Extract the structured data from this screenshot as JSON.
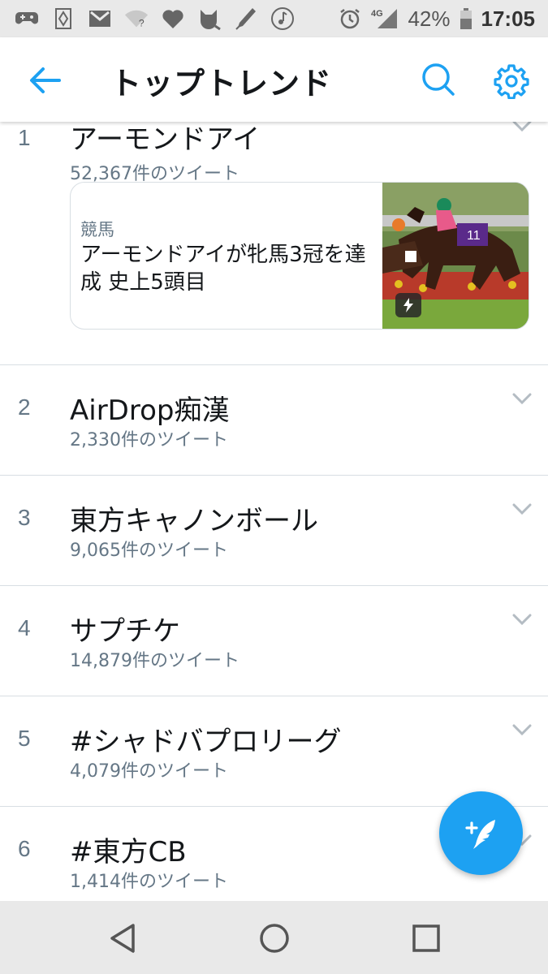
{
  "status_bar": {
    "left_icons": [
      "game-controller-icon",
      "sync-diamond-icon",
      "gmail-icon",
      "wifi-unknown-icon",
      "heart-icon",
      "cat-icon",
      "pen-icon",
      "music-note-icon"
    ],
    "network": "4G",
    "battery": "42%",
    "time": "17:05"
  },
  "app_bar": {
    "title": "トップトレンド",
    "accent_color": "#1da1f2"
  },
  "trends": [
    {
      "rank": "1",
      "name": "アーモンドアイ",
      "count": "52,367件のツイート",
      "news": {
        "category": "競馬",
        "headline": "アーモンドアイが牝馬3冠を達成 史上5頭目",
        "thumbnail": "horse-race-photo",
        "badge_icon": "lightning-icon"
      }
    },
    {
      "rank": "2",
      "name": "AirDrop痴漢",
      "count": "2,330件のツイート"
    },
    {
      "rank": "3",
      "name": "東方キャノンボール",
      "count": "9,065件のツイート"
    },
    {
      "rank": "4",
      "name": "サプチケ",
      "count": "14,879件のツイート"
    },
    {
      "rank": "5",
      "name": "#シャドバプロリーグ",
      "count": "4,079件のツイート"
    },
    {
      "rank": "6",
      "name": "#東方CB",
      "count": "1,414件のツイート"
    }
  ],
  "fab": {
    "icon": "compose-tweet-icon"
  },
  "nav_bar": {
    "buttons": [
      "back-triangle-icon",
      "home-circle-icon",
      "recents-square-icon"
    ]
  }
}
